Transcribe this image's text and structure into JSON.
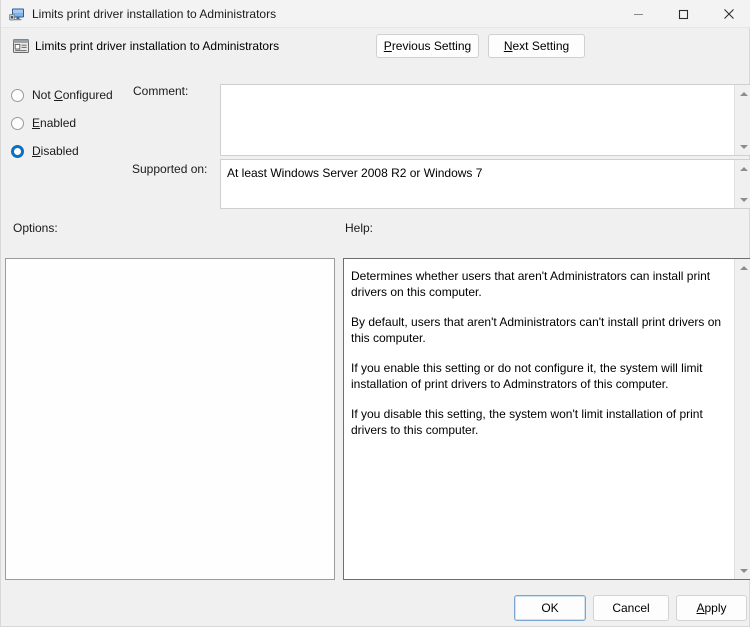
{
  "window": {
    "title": "Limits print driver installation to Administrators",
    "title_icon": "computer-monitor-icon",
    "minimize_label": "Minimize",
    "maximize_label": "Maximize",
    "close_label": "Close"
  },
  "setting_header": {
    "icon": "policy-setting-icon",
    "title": "Limits print driver installation to Administrators",
    "previous_setting_accel": "P",
    "previous_setting_rest": "revious Setting",
    "next_setting_accel": "N",
    "next_setting_rest": "ext Setting"
  },
  "state_options": [
    {
      "id": "not-configured",
      "accel": "C",
      "before": "Not ",
      "after": "onfigured",
      "selected": false
    },
    {
      "id": "enabled",
      "accel": "E",
      "before": "",
      "after": "nabled",
      "selected": false
    },
    {
      "id": "disabled",
      "accel": "D",
      "before": "",
      "after": "isabled",
      "selected": true
    }
  ],
  "fields": {
    "comment_label": "Comment:",
    "comment_value": "",
    "supported_label": "Supported on:",
    "supported_value": "At least Windows Server 2008 R2 or Windows 7"
  },
  "panes": {
    "options_label": "Options:",
    "options_content": "",
    "help_label": "Help:",
    "help_paragraphs": [
      "Determines whether users that aren't Administrators can install print drivers on this computer.",
      "By default, users that aren't Administrators can't install print drivers on this computer.",
      "If you enable this setting or do not configure it, the system will limit installation of print drivers to Adminstrators of this computer.",
      "If you disable this setting, the system won't limit installation of print drivers to this computer."
    ]
  },
  "buttons": {
    "ok": "OK",
    "cancel": "Cancel",
    "apply_accel": "A",
    "apply_rest": "pply"
  },
  "colors": {
    "accent": "#0d6fbe",
    "window_background": "#f0f0f0",
    "titlebar_background": "#f3f3f3",
    "field_background": "#ffffff"
  }
}
